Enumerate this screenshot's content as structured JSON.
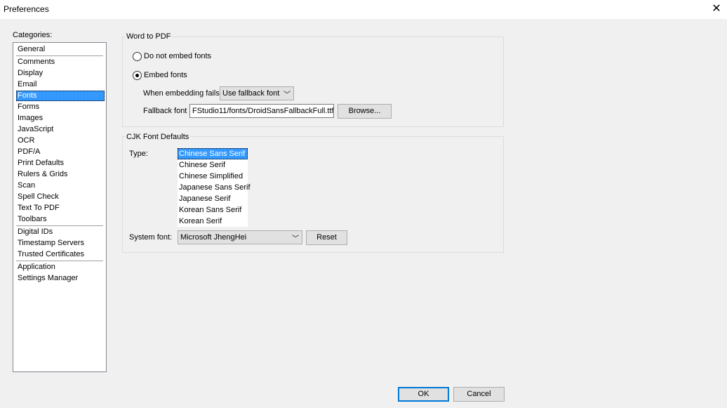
{
  "window": {
    "title": "Preferences"
  },
  "categories": {
    "label": "Categories:",
    "items": [
      "General",
      "Comments",
      "Display",
      "Email",
      "Fonts",
      "Forms",
      "Images",
      "JavaScript",
      "OCR",
      "PDF/A",
      "Print Defaults",
      "Rulers & Grids",
      "Scan",
      "Spell Check",
      "Text To PDF",
      "Toolbars",
      "Digital IDs",
      "Timestamp Servers",
      "Trusted Certificates",
      "Application",
      "Settings Manager"
    ],
    "selected": "Fonts"
  },
  "word_to_pdf": {
    "title": "Word to PDF",
    "radio_no_embed": "Do not embed fonts",
    "radio_embed": "Embed fonts",
    "selected_option": "Embed fonts",
    "when_fails_label": "When embedding fails",
    "when_fails_value": "Use fallback font",
    "fallback_label": "Fallback font",
    "fallback_value": "FStudio11/fonts/DroidSansFallbackFull.ttf",
    "browse_label": "Browse..."
  },
  "cjk": {
    "title": "CJK Font Defaults",
    "type_label": "Type:",
    "types": [
      "Chinese Sans Serif",
      "Chinese Serif",
      "Chinese Simplified",
      "Japanese Sans Serif",
      "Japanese Serif",
      "Korean Sans Serif",
      "Korean Serif"
    ],
    "selected_type": "Chinese Sans Serif",
    "system_font_label": "System font:",
    "system_font_value": "Microsoft JhengHei",
    "reset_label": "Reset"
  },
  "footer": {
    "ok_label": "OK",
    "cancel_label": "Cancel"
  },
  "colors": {
    "selection": "#3399ff",
    "default_button_border": "#0078d7",
    "dialog_bg": "#f0f0f0"
  },
  "icons": {
    "close": "close-icon",
    "dropdown": "chevron-down-icon"
  }
}
